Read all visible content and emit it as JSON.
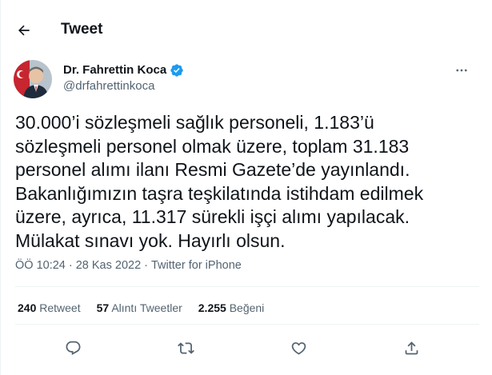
{
  "header": {
    "title": "Tweet",
    "back_icon": "arrow-left-icon"
  },
  "author": {
    "name": "Dr. Fahrettin Koca",
    "handle": "@drfahrettinkoca",
    "verified_icon": "verified-badge-icon",
    "verified_color": "#1d9bf0",
    "more_icon": "more-horizontal-icon"
  },
  "tweet": {
    "text": "30.000’i sözleşmeli sağlık personeli, 1.183’ü\nsözleşmeli personel olmak üzere, toplam 31.183\npersonel alımı ilanı Resmi Gazete’de yayınlandı.\nBakanlığımızın taşra teşkilatında istihdam edilmek\nüzere, ayrıca, 11.317 sürekli işçi alımı yapılacak.\nMülakat sınavı yok. Hayırlı olsun.",
    "time": "ÖÖ 10:24",
    "separator": "·",
    "date": "28 Kas 2022",
    "source": "Twitter for iPhone"
  },
  "stats": {
    "retweets_count": "240",
    "retweets_label": "Retweet",
    "quotes_count": "57",
    "quotes_label": "Alıntı Tweetler",
    "likes_count": "2.255",
    "likes_label": "Beğeni"
  },
  "actions": [
    {
      "name": "reply",
      "icon": "reply-icon"
    },
    {
      "name": "retweet",
      "icon": "retweet-icon"
    },
    {
      "name": "like",
      "icon": "heart-icon"
    },
    {
      "name": "share",
      "icon": "share-icon"
    }
  ],
  "colors": {
    "text": "#0f1419",
    "secondary": "#536471",
    "border": "#eff3f4",
    "accent": "#1d9bf0"
  }
}
